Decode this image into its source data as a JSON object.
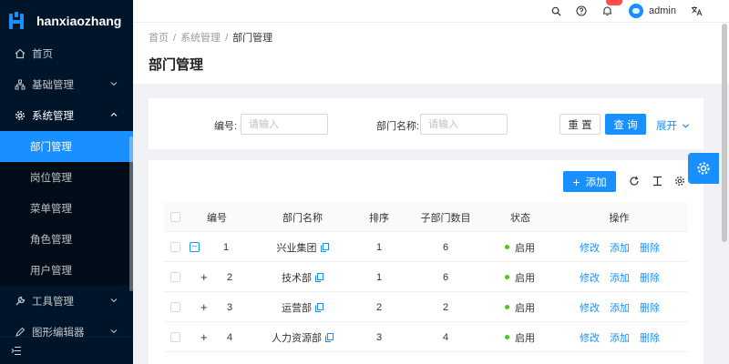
{
  "app": {
    "logo_text": "hanxiaozhang"
  },
  "sidebar": {
    "items": [
      {
        "label": "首页",
        "icon": "home-icon"
      },
      {
        "label": "基础管理",
        "icon": "cluster-icon",
        "expandable": true,
        "open": false
      },
      {
        "label": "系统管理",
        "icon": "gear-icon",
        "expandable": true,
        "open": true,
        "children": [
          {
            "label": "部门管理",
            "active": true
          },
          {
            "label": "岗位管理"
          },
          {
            "label": "菜单管理"
          },
          {
            "label": "角色管理"
          },
          {
            "label": "用户管理"
          }
        ]
      },
      {
        "label": "工具管理",
        "icon": "tool-icon",
        "expandable": true,
        "open": false
      },
      {
        "label": "图形编辑器",
        "icon": "edit-icon",
        "expandable": true,
        "open": false
      }
    ]
  },
  "header": {
    "username": "admin",
    "icons": [
      "search-icon",
      "question-icon",
      "bell-icon",
      "translate-icon"
    ],
    "accent_color": "#1890ff"
  },
  "breadcrumb": {
    "items": [
      "首页",
      "系统管理",
      "部门管理"
    ],
    "separator": "/"
  },
  "page": {
    "title": "部门管理"
  },
  "search": {
    "id_label": "编号:",
    "id_placeholder": "请输入",
    "name_label": "部门名称:",
    "name_placeholder": "请输入",
    "reset_label": "重 置",
    "query_label": "查 询",
    "expand_label": "展开"
  },
  "table": {
    "add_label": "添加",
    "columns": [
      "编号",
      "部门名称",
      "排序",
      "子部门数目",
      "状态",
      "操作"
    ],
    "rows": [
      {
        "id": "1",
        "name": "兴业集团",
        "sort": "1",
        "children": "6",
        "status": "启用",
        "expanded": true
      },
      {
        "id": "2",
        "name": "技术部",
        "sort": "1",
        "children": "6",
        "status": "启用"
      },
      {
        "id": "3",
        "name": "运营部",
        "sort": "2",
        "children": "2",
        "status": "启用"
      },
      {
        "id": "4",
        "name": "人力资源部",
        "sort": "3",
        "children": "4",
        "status": "启用"
      }
    ],
    "actions": {
      "edit": "修改",
      "add": "添加",
      "delete": "删除"
    },
    "status_color": "#52c41a"
  }
}
